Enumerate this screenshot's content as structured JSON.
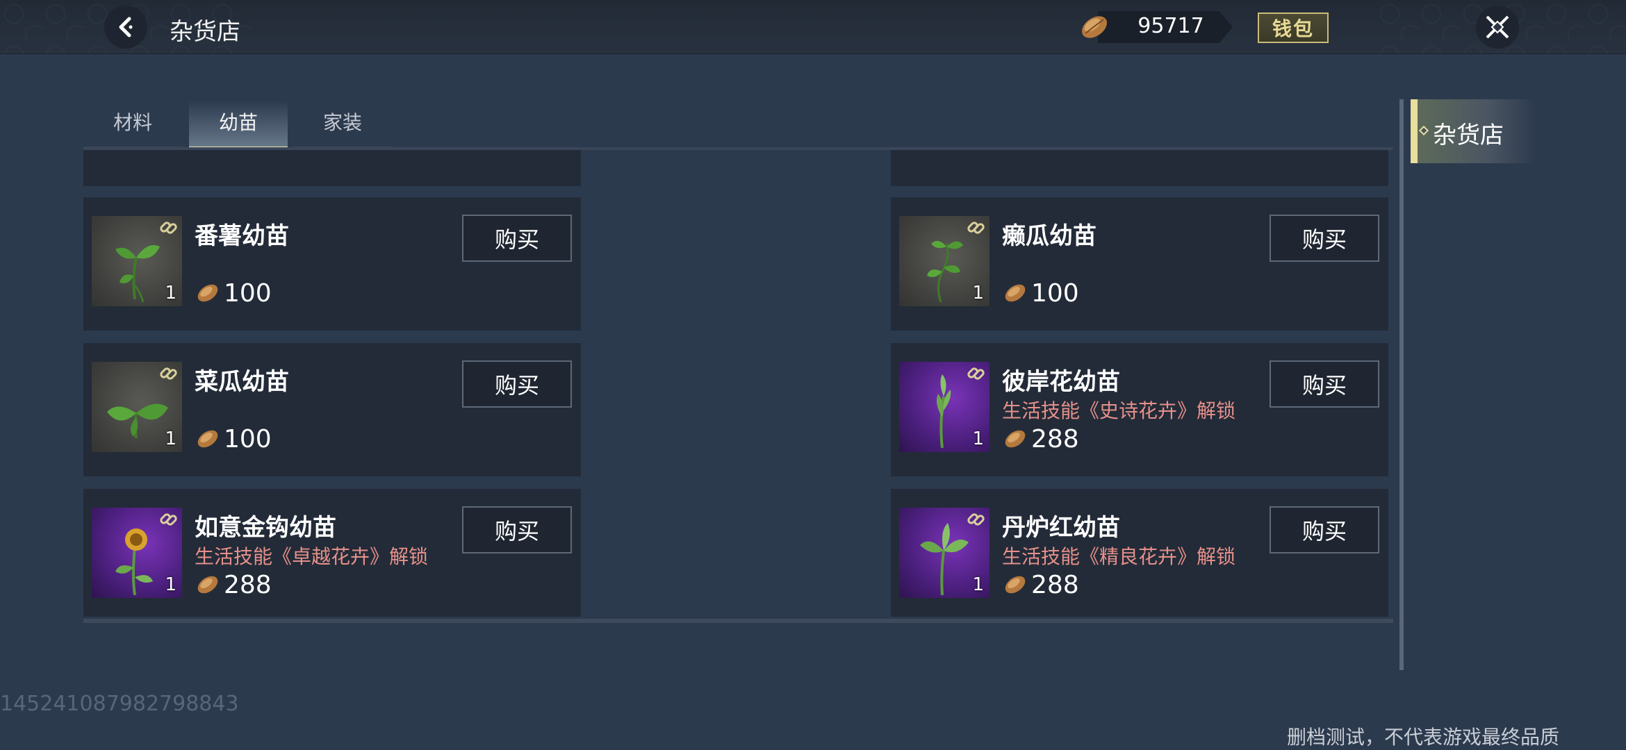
{
  "header": {
    "title": "杂货店",
    "currency_amount": "95717",
    "wallet_label": "钱包"
  },
  "tabs": [
    {
      "label": "材料",
      "active": false
    },
    {
      "label": "幼苗",
      "active": true
    },
    {
      "label": "家装",
      "active": false
    }
  ],
  "items": [
    {
      "name": "番薯幼苗",
      "quantity": "1",
      "unlock": "",
      "price": "100",
      "buy_label": "购买",
      "thumb": "gray"
    },
    {
      "name": "癞瓜幼苗",
      "quantity": "1",
      "unlock": "",
      "price": "100",
      "buy_label": "购买",
      "thumb": "gray"
    },
    {
      "name": "菜瓜幼苗",
      "quantity": "1",
      "unlock": "",
      "price": "100",
      "buy_label": "购买",
      "thumb": "gray"
    },
    {
      "name": "彼岸花幼苗",
      "quantity": "1",
      "unlock": "生活技能《史诗花卉》解锁",
      "price": "288",
      "buy_label": "购买",
      "thumb": "purple"
    },
    {
      "name": "如意金钩幼苗",
      "quantity": "1",
      "unlock": "生活技能《卓越花卉》解锁",
      "price": "288",
      "buy_label": "购买",
      "thumb": "purple"
    },
    {
      "name": "丹炉红幼苗",
      "quantity": "1",
      "unlock": "生活技能《精良花卉》解锁",
      "price": "288",
      "buy_label": "购买",
      "thumb": "purple"
    }
  ],
  "side_tabs": [
    {
      "label": "杂货店",
      "active": true
    }
  ],
  "footer": {
    "id_text": "14524108798279884​3",
    "disclaimer": "删档测试，不代表游戏最终品质"
  },
  "colors": {
    "background": "#2c3a4e",
    "card": "#232b38",
    "unlock_text": "#e6908a",
    "wallet_gold": "#c9bd7a",
    "purple_rarity": "#5a259a"
  },
  "icons": {
    "back": "chevron-left-icon",
    "close": "close-x-icon",
    "currency": "seed-coin-icon",
    "link": "chain-link-icon"
  }
}
